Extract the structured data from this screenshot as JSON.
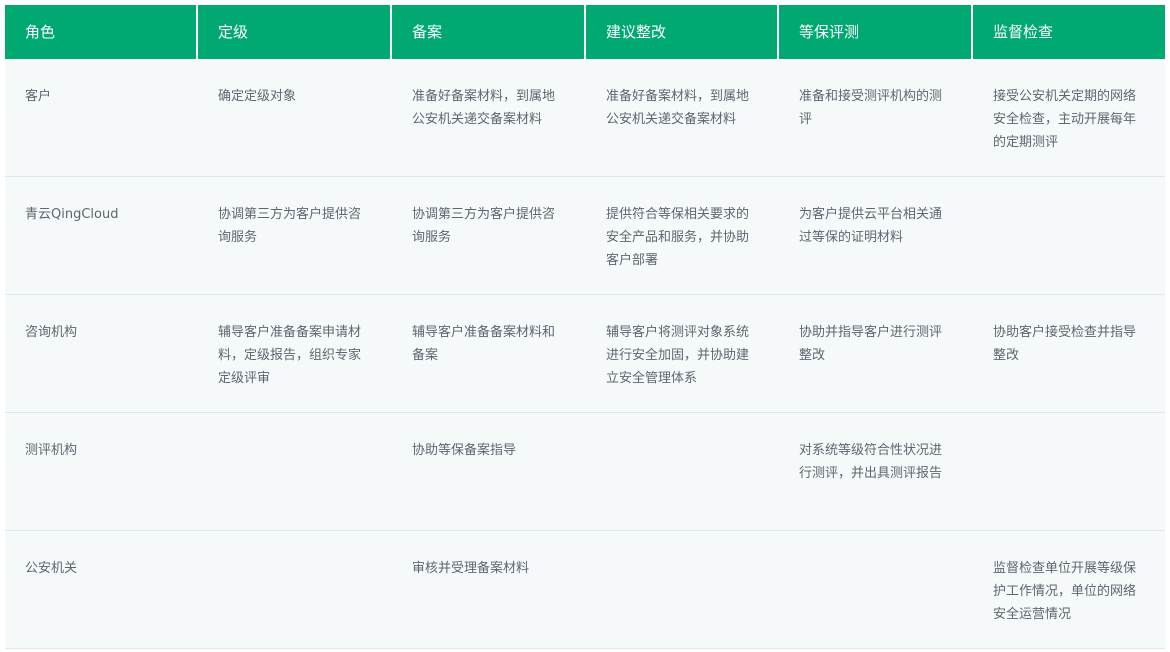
{
  "table": {
    "headers": [
      "角色",
      "定级",
      "备案",
      "建议整改",
      "等保评测",
      "监督检查"
    ],
    "rows": [
      {
        "role": "客户",
        "cells": [
          "确定定级对象",
          "准备好备案材料，到属地公安机关递交备案材料",
          "准备好备案材料，到属地公安机关递交备案材料",
          "准备和接受测评机构的测评",
          "接受公安机关定期的网络安全检查，主动开展每年的定期测评"
        ]
      },
      {
        "role": "青云QingCloud",
        "cells": [
          "协调第三方为客户提供咨询服务",
          "协调第三方为客户提供咨询服务",
          "提供符合等保相关要求的安全产品和服务，并协助客户部署",
          "为客户提供云平台相关通过等保的证明材料",
          ""
        ]
      },
      {
        "role": "咨询机构",
        "cells": [
          "辅导客户准备备案申请材料，定级报告，组织专家定级评审",
          "辅导客户准备备案材料和备案",
          "辅导客户将测评对象系统进行安全加固，并协助建立安全管理体系",
          "协助并指导客户进行测评整改",
          "协助客户接受检查并指导整改"
        ]
      },
      {
        "role": "测评机构",
        "cells": [
          "",
          "协助等保备案指导",
          "",
          "对系统等级符合性状况进行测评，并出具测评报告",
          ""
        ]
      },
      {
        "role": "公安机关",
        "cells": [
          "",
          "审核并受理备案材料",
          "",
          "",
          "监督检查单位开展等级保护工作情况，单位的网络安全运营情况"
        ]
      }
    ]
  }
}
